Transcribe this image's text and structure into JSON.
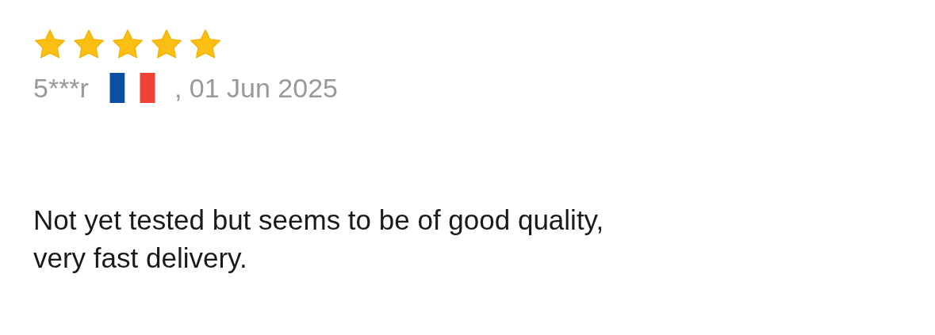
{
  "review": {
    "stars": 5,
    "author": "5***r",
    "date": ", 01 Jun 2025",
    "text": "Not yet tested but seems to be of good quality, very fast delivery."
  }
}
